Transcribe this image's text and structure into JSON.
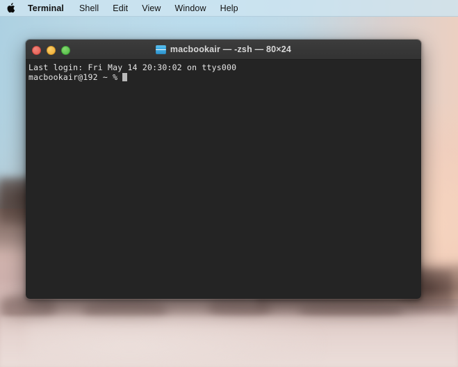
{
  "menubar": {
    "apple_icon": "apple-logo-icon",
    "items": [
      {
        "label": "Terminal",
        "bold": true
      },
      {
        "label": "Shell",
        "bold": false
      },
      {
        "label": "Edit",
        "bold": false
      },
      {
        "label": "View",
        "bold": false
      },
      {
        "label": "Window",
        "bold": false
      },
      {
        "label": "Help",
        "bold": false
      }
    ]
  },
  "window": {
    "title": "macbookair — -zsh — 80×24",
    "title_icon": "terminal-folder-icon",
    "controls": {
      "close": "close-button",
      "minimize": "minimize-button",
      "maximize": "maximize-button"
    },
    "colors": {
      "titlebar": "#373737",
      "body": "#242424",
      "text": "#e6e6e6",
      "close": "#e25a4f",
      "minimize": "#edab32",
      "maximize": "#4fb944"
    }
  },
  "terminal": {
    "lines": [
      "Last login: Fri May 14 20:30:02 on ttys000",
      "macbookair@192 ~ % "
    ],
    "prompt": "macbookair@192 ~ % ",
    "last_login": "Last login: Fri May 14 20:30:02 on ttys000",
    "cursor": "block"
  },
  "desktop": {
    "wallpaper": "blurred-lake-at-dusk",
    "colors": {
      "sky_top": "#b9dbec",
      "glow": "#f4ceba",
      "water": "#e3d2ce",
      "menubar": "#cde4f0"
    }
  }
}
